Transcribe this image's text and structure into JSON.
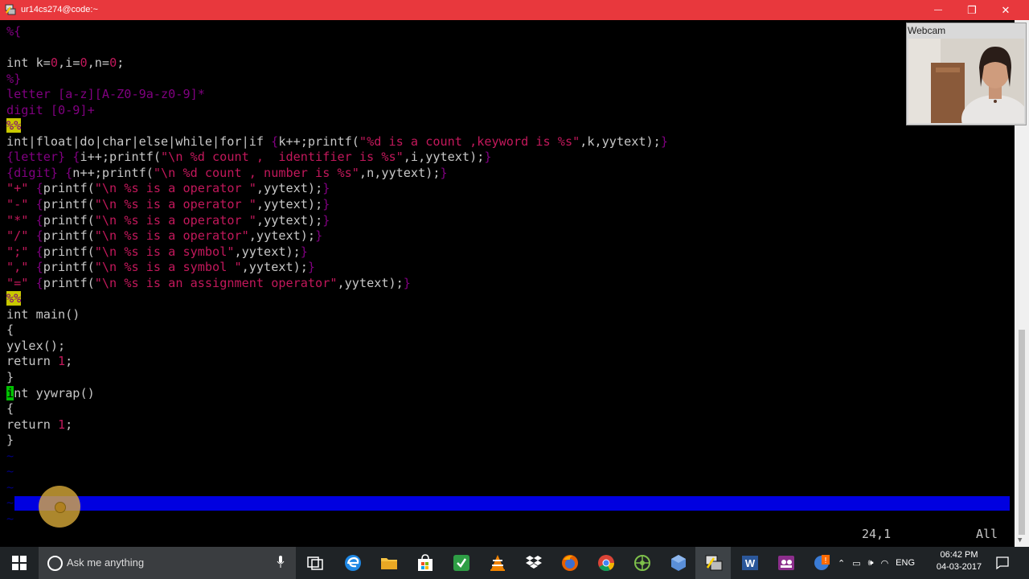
{
  "window": {
    "title": "ur14cs274@code:~",
    "minimize": "—",
    "maximize": "❐",
    "close": "✕"
  },
  "code_lines": [
    [
      [
        "e",
        "%{"
      ]
    ],
    [
      [
        "k",
        ""
      ]
    ],
    [
      [
        "k",
        "int k="
      ],
      [
        "n",
        "0"
      ],
      [
        "k",
        ",i="
      ],
      [
        "n",
        "0"
      ],
      [
        "k",
        ",n="
      ],
      [
        "n",
        "0"
      ],
      [
        "k",
        ";"
      ]
    ],
    [
      [
        "e",
        "%}"
      ]
    ],
    [
      [
        "e",
        "letter [a-z][A-Z0-9a-z0-9]*"
      ]
    ],
    [
      [
        "e",
        "digit [0-9]+"
      ]
    ],
    [
      [
        "hl",
        "%%"
      ]
    ],
    [
      [
        "k",
        "int|float|do|char|else|while|for|if "
      ],
      [
        "e",
        "{"
      ],
      [
        "k",
        "k++;printf("
      ],
      [
        "n",
        "\"%d is a count ,keyword is %s\""
      ],
      [
        "k",
        ",k,yytext);"
      ],
      [
        "e",
        "}"
      ]
    ],
    [
      [
        "e",
        "{letter} {"
      ],
      [
        "k",
        "i++;printf("
      ],
      [
        "n",
        "\"\\n %d count ,  identifier is %s\""
      ],
      [
        "k",
        ",i,yytext);"
      ],
      [
        "e",
        "}"
      ]
    ],
    [
      [
        "e",
        "{digit} {"
      ],
      [
        "k",
        "n++;printf("
      ],
      [
        "n",
        "\"\\n %d count , number is %s\""
      ],
      [
        "k",
        ",n,yytext);"
      ],
      [
        "e",
        "}"
      ]
    ],
    [
      [
        "n",
        "\"+\" "
      ],
      [
        "e",
        "{"
      ],
      [
        "k",
        "printf("
      ],
      [
        "n",
        "\"\\n %s is a operator \""
      ],
      [
        "k",
        ",yytext);"
      ],
      [
        "e",
        "}"
      ]
    ],
    [
      [
        "n",
        "\"-\" "
      ],
      [
        "e",
        "{"
      ],
      [
        "k",
        "printf("
      ],
      [
        "n",
        "\"\\n %s is a operator \""
      ],
      [
        "k",
        ",yytext);"
      ],
      [
        "e",
        "}"
      ]
    ],
    [
      [
        "n",
        "\"*\" "
      ],
      [
        "e",
        "{"
      ],
      [
        "k",
        "printf("
      ],
      [
        "n",
        "\"\\n %s is a operator \""
      ],
      [
        "k",
        ",yytext);"
      ],
      [
        "e",
        "}"
      ]
    ],
    [
      [
        "n",
        "\"/\" "
      ],
      [
        "e",
        "{"
      ],
      [
        "k",
        "printf("
      ],
      [
        "n",
        "\"\\n %s is a operator\""
      ],
      [
        "k",
        ",yytext);"
      ],
      [
        "e",
        "}"
      ]
    ],
    [
      [
        "n",
        "\";\" "
      ],
      [
        "e",
        "{"
      ],
      [
        "k",
        "printf("
      ],
      [
        "n",
        "\"\\n %s is a symbol\""
      ],
      [
        "k",
        ",yytext);"
      ],
      [
        "e",
        "}"
      ]
    ],
    [
      [
        "n",
        "\",\" "
      ],
      [
        "e",
        "{"
      ],
      [
        "k",
        "printf("
      ],
      [
        "n",
        "\"\\n %s is a symbol \""
      ],
      [
        "k",
        ",yytext);"
      ],
      [
        "e",
        "}"
      ]
    ],
    [
      [
        "n",
        "\"=\" "
      ],
      [
        "e",
        "{"
      ],
      [
        "k",
        "printf("
      ],
      [
        "n",
        "\"\\n %s is an assignment operator\""
      ],
      [
        "k",
        ",yytext);"
      ],
      [
        "e",
        "}"
      ]
    ],
    [
      [
        "hl",
        "%%"
      ]
    ],
    [
      [
        "k",
        "int main()"
      ]
    ],
    [
      [
        "k",
        "{"
      ]
    ],
    [
      [
        "k",
        "yylex();"
      ]
    ],
    [
      [
        "k",
        "return "
      ],
      [
        "n",
        "1"
      ],
      [
        "k",
        ";"
      ]
    ],
    [
      [
        "k",
        "}"
      ]
    ],
    [
      [
        "cur",
        "i"
      ],
      [
        "k",
        "nt yywrap()"
      ]
    ],
    [
      [
        "k",
        "{"
      ]
    ],
    [
      [
        "k",
        "return "
      ],
      [
        "n",
        "1"
      ],
      [
        "k",
        ";"
      ]
    ],
    [
      [
        "k",
        "}"
      ]
    ],
    [
      [
        "t",
        "~"
      ]
    ],
    [
      [
        "t",
        "~"
      ]
    ],
    [
      [
        "t",
        "~"
      ]
    ],
    [
      [
        "t",
        "~"
      ]
    ],
    [
      [
        "t",
        "~"
      ]
    ]
  ],
  "status": {
    "position": "24,1",
    "scroll": "All"
  },
  "webcam": {
    "label": "Webcam"
  },
  "taskbar": {
    "search_placeholder": "Ask me anything",
    "language": "ENG",
    "time": "06:42 PM",
    "date": "04-03-2017"
  },
  "colors": {
    "titlebar": "#e8383d",
    "terminal_bg": "#000000",
    "vim_status": "#0000e0",
    "preproc": "#800080",
    "constant": "#c2185b",
    "search_highlight": "#c8c800",
    "cursor": "#00c000"
  }
}
